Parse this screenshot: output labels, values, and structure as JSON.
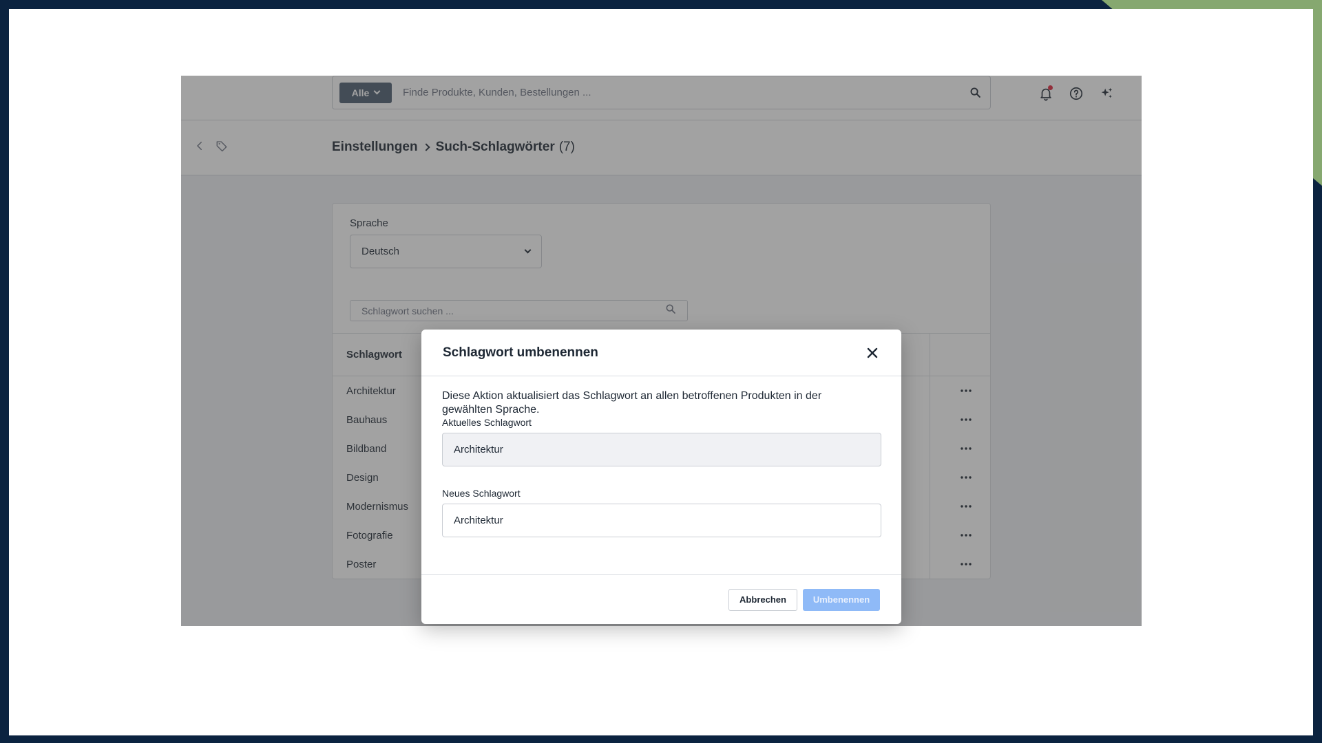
{
  "topbar": {
    "scope_label": "Alle",
    "search_placeholder": "Finde Produkte, Kunden, Bestellungen ..."
  },
  "breadcrumb": {
    "parent": "Einstellungen",
    "current": "Such-Schlagwörter",
    "count": "(7)"
  },
  "filters": {
    "language_label": "Sprache",
    "language_value": "Deutsch",
    "keyword_search_placeholder": "Schlagwort suchen ..."
  },
  "table": {
    "header": "Schlagwort",
    "rows": [
      "Architektur",
      "Bauhaus",
      "Bildband",
      "Design",
      "Modernismus",
      "Fotografie",
      "Poster"
    ]
  },
  "modal": {
    "title": "Schlagwort umbenennen",
    "description": "Diese Aktion aktualisiert das Schlagwort an allen betroffenen Produkten in der gewählten Sprache.",
    "current_label": "Aktuelles Schlagwort",
    "current_value": "Architektur",
    "new_label": "Neues Schlagwort",
    "new_value": "Architektur",
    "cancel_label": "Abbrechen",
    "confirm_label": "Umbenennen"
  },
  "colors": {
    "frame": "#0b2340",
    "accent": "#86a870",
    "primary_disabled": "#8fbaf7",
    "notification_dot": "#e0233a"
  }
}
